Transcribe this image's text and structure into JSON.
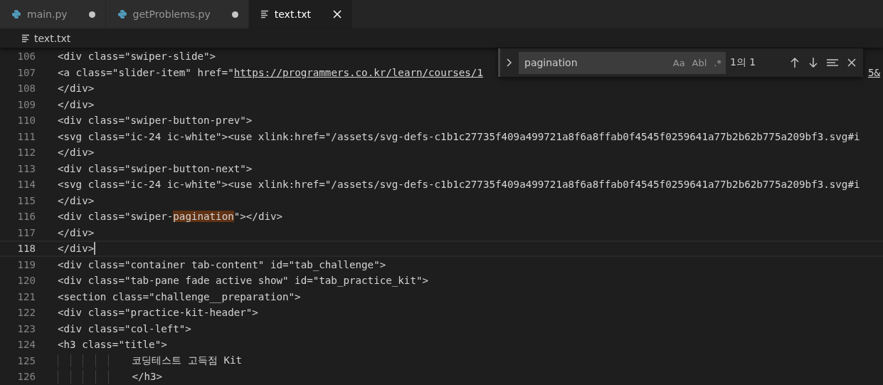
{
  "tabs": [
    {
      "label": "main.py",
      "kind": "python",
      "selected": false,
      "dirty": true
    },
    {
      "label": "getProblems.py",
      "kind": "python",
      "selected": false,
      "dirty": true
    },
    {
      "label": "text.txt",
      "kind": "text",
      "selected": true,
      "dirty": false
    }
  ],
  "breadcrumb": {
    "label": "text.txt"
  },
  "find_widget": {
    "expanded": false,
    "value": "pagination",
    "options": [
      "Aa",
      "Abl",
      ".*"
    ],
    "result": "1의 1"
  },
  "lines": [
    {
      "number": "106",
      "current": false,
      "indented": false,
      "segments": [
        {
          "kind": "plain",
          "text": "<div class=\"swiper-slide\">"
        }
      ]
    },
    {
      "number": "107",
      "current": false,
      "indented": false,
      "segments": [
        {
          "kind": "plain",
          "text": "<a class=\"slider-item\" href=\""
        },
        {
          "kind": "link",
          "text": "https://programmers.co.kr/learn/courses/1"
        }
      ],
      "tail": "5&"
    },
    {
      "number": "108",
      "current": false,
      "indented": false,
      "segments": [
        {
          "kind": "plain",
          "text": "</div>"
        }
      ]
    },
    {
      "number": "109",
      "current": false,
      "indented": false,
      "segments": [
        {
          "kind": "plain",
          "text": "</div>"
        }
      ]
    },
    {
      "number": "110",
      "current": false,
      "indented": false,
      "segments": [
        {
          "kind": "plain",
          "text": "<div class=\"swiper-button-prev\">"
        }
      ]
    },
    {
      "number": "111",
      "current": false,
      "indented": false,
      "segments": [
        {
          "kind": "plain",
          "text": "<svg class=\"ic-24 ic-white\"><use xlink:href=\"/assets/svg-defs-c1b1c27735f409a499721a8f6a8ffab0f4545f0259641a77b2b62b775a209bf3.svg#i"
        }
      ]
    },
    {
      "number": "112",
      "current": false,
      "indented": false,
      "segments": [
        {
          "kind": "plain",
          "text": "</div>"
        }
      ]
    },
    {
      "number": "113",
      "current": false,
      "indented": false,
      "segments": [
        {
          "kind": "plain",
          "text": "<div class=\"swiper-button-next\">"
        }
      ]
    },
    {
      "number": "114",
      "current": false,
      "indented": false,
      "segments": [
        {
          "kind": "plain",
          "text": "<svg class=\"ic-24 ic-white\"><use xlink:href=\"/assets/svg-defs-c1b1c27735f409a499721a8f6a8ffab0f4545f0259641a77b2b62b775a209bf3.svg#i"
        }
      ]
    },
    {
      "number": "115",
      "current": false,
      "indented": false,
      "segments": [
        {
          "kind": "plain",
          "text": "</div>"
        }
      ]
    },
    {
      "number": "116",
      "current": false,
      "indented": false,
      "segments": [
        {
          "kind": "plain",
          "text": "<div class=\"swiper-"
        },
        {
          "kind": "match",
          "text": "pagination"
        },
        {
          "kind": "plain",
          "text": "\"></div>"
        }
      ]
    },
    {
      "number": "117",
      "current": false,
      "indented": false,
      "segments": [
        {
          "kind": "plain",
          "text": "</div>"
        }
      ]
    },
    {
      "number": "118",
      "current": true,
      "indented": false,
      "segments": [
        {
          "kind": "plain",
          "text": "</div>"
        }
      ]
    },
    {
      "number": "119",
      "current": false,
      "indented": false,
      "segments": [
        {
          "kind": "plain",
          "text": "<div class=\"container tab-content\" id=\"tab_challenge\">"
        }
      ]
    },
    {
      "number": "120",
      "current": false,
      "indented": false,
      "segments": [
        {
          "kind": "plain",
          "text": "<div class=\"tab-pane fade active show\" id=\"tab_practice_kit\">"
        }
      ]
    },
    {
      "number": "121",
      "current": false,
      "indented": false,
      "segments": [
        {
          "kind": "plain",
          "text": "<section class=\"challenge__preparation\">"
        }
      ]
    },
    {
      "number": "122",
      "current": false,
      "indented": false,
      "segments": [
        {
          "kind": "plain",
          "text": "<div class=\"practice-kit-header\">"
        }
      ]
    },
    {
      "number": "123",
      "current": false,
      "indented": false,
      "segments": [
        {
          "kind": "plain",
          "text": "<div class=\"col-left\">"
        }
      ]
    },
    {
      "number": "124",
      "current": false,
      "indented": false,
      "segments": [
        {
          "kind": "plain",
          "text": "<h3 class=\"title\">"
        }
      ]
    },
    {
      "number": "125",
      "current": false,
      "indented": true,
      "segments": [
        {
          "kind": "plain",
          "text": "코딩테스트 고득점 Kit"
        }
      ]
    },
    {
      "number": "126",
      "current": false,
      "indented": true,
      "segments": [
        {
          "kind": "plain",
          "text": "</h3>"
        }
      ]
    }
  ]
}
